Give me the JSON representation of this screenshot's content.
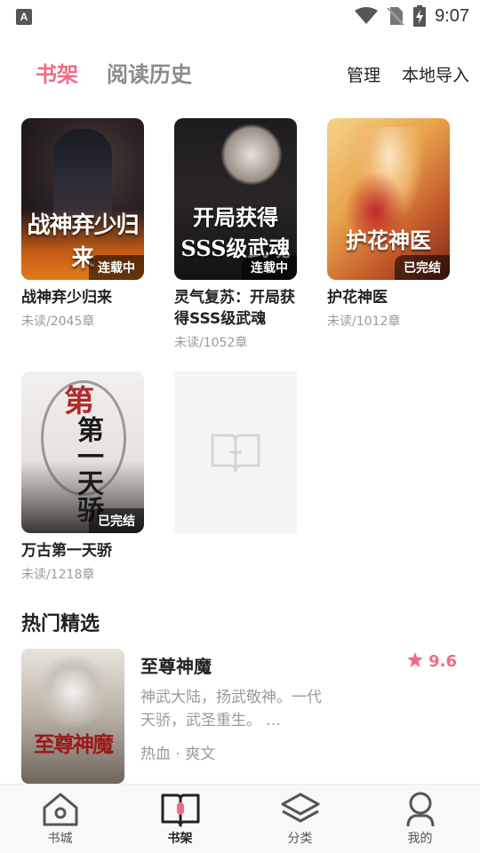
{
  "status_bar": {
    "time": "9:07",
    "app_icon": "A"
  },
  "header": {
    "tabs": [
      {
        "label": "书架",
        "active": true
      },
      {
        "label": "阅读历史",
        "active": false
      }
    ],
    "actions": [
      {
        "label": "管理"
      },
      {
        "label": "本地导入"
      }
    ]
  },
  "books": [
    {
      "title": "战神弃少归来",
      "progress": "未读/2045章",
      "badge": "连载中",
      "cover_text": "战神弃少归来"
    },
    {
      "title": "灵气复苏：开局获得SSS级武魂",
      "progress": "未读/1052章",
      "badge": "连载中",
      "cover_text": "开局获得SSS级武魂"
    },
    {
      "title": "护花神医",
      "progress": "未读/1012章",
      "badge": "已完结",
      "cover_text": "护花神医"
    },
    {
      "title": "万古第一天骄",
      "progress": "未读/1218章",
      "badge": "已完结",
      "cover_text": "第一天骄"
    }
  ],
  "hot": {
    "section_title": "热门精选",
    "item": {
      "name": "至尊神魔",
      "rating": "9.6",
      "description": "神武大陆，扬武敬神。一代天骄，武圣重生。 ...",
      "tags": "热血 · 爽文",
      "cover_text": "至尊神魔"
    }
  },
  "bottom_nav": [
    {
      "label": "书城",
      "icon": "home-icon",
      "active": false
    },
    {
      "label": "书架",
      "icon": "bookshelf-icon",
      "active": true
    },
    {
      "label": "分类",
      "icon": "layers-icon",
      "active": false
    },
    {
      "label": "我的",
      "icon": "profile-icon",
      "active": false
    }
  ],
  "colors": {
    "accent": "#f06a86",
    "muted": "#9a9a9a",
    "nav_bg": "#f7f8f9"
  }
}
